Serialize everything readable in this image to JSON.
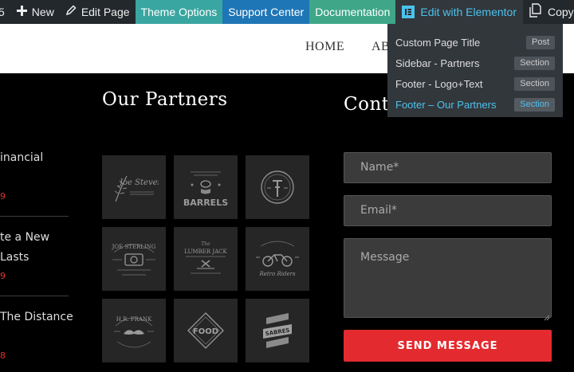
{
  "adminbar": {
    "count": "5",
    "new_label": "New",
    "edit_page_label": "Edit Page",
    "theme_options_label": "Theme Options",
    "support_center_label": "Support Center",
    "documentation_label": "Documentation",
    "elementor_label": "Edit with Elementor",
    "copy_label": "Copy to a"
  },
  "elementor_menu": [
    {
      "label": "Custom Page Title",
      "tag": "Post"
    },
    {
      "label": "Sidebar - Partners",
      "tag": "Section"
    },
    {
      "label": "Footer - Logo+Text",
      "tag": "Section"
    },
    {
      "label": "Footer – Our Partners",
      "tag": "Section"
    }
  ],
  "nav": {
    "home": "HOME",
    "about": "AB"
  },
  "posts": [
    {
      "line1": "inancial",
      "line2": "",
      "date": "9"
    },
    {
      "line1": "te a New",
      "line2": "Lasts",
      "date": "9"
    },
    {
      "line1": "The Distance",
      "line2": "",
      "date": "8"
    }
  ],
  "partners": {
    "title": "Our Partners",
    "logos": [
      "Joe Steven",
      "Barrels",
      "Bicycle Badge",
      "Joe Sterling",
      "The Lumber Jack",
      "Retro Rides",
      "H.R. Frank",
      "Food",
      "Sabres"
    ],
    "logo_texts": {
      "joe_steven": "Joe Steven",
      "barrels": "BARRELS",
      "joe_sterling": "JOE STERLING",
      "lumber_jack": "LUMBER JACK",
      "retro_rides": "Retro Riders",
      "hr_frank": "H.R. FRANK",
      "food": "FOOD",
      "sabres": "SABRES"
    }
  },
  "contact": {
    "title": "Cont",
    "name_placeholder": "Name*",
    "email_placeholder": "Email*",
    "message_placeholder": "Message",
    "send_label": "SEND MESSAGE"
  },
  "colors": {
    "adminbar": "#23282d",
    "theme_options": "#3aa6a1",
    "support_center": "#1f76b6",
    "documentation": "#3fa788",
    "elementor_accent": "#4dc2ec",
    "send_button": "#e32b2f",
    "date_red": "#e0322e"
  }
}
